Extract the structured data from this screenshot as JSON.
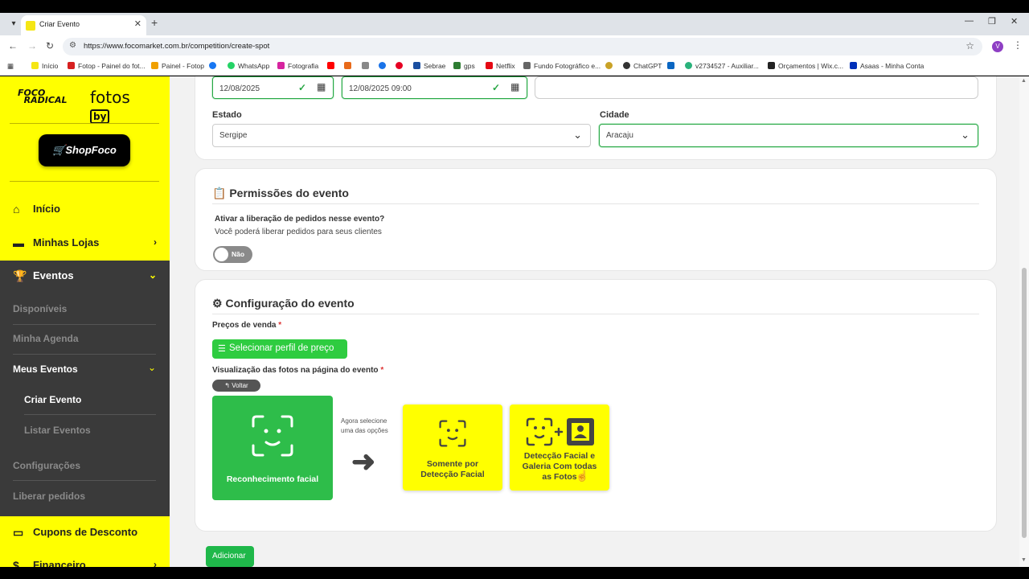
{
  "browser": {
    "tab_title": "Criar Evento",
    "url": "https://www.focomarket.com.br/competition/create-spot",
    "profile_initial": "V",
    "bookmarks": [
      {
        "label": "Início",
        "color": "#f5e614"
      },
      {
        "label": "Fotop - Painel do fot...",
        "color": "#d62020"
      },
      {
        "label": "Painel - Fotop",
        "color": "#f0a000"
      },
      {
        "label": "",
        "color": "#1877f2"
      },
      {
        "label": "WhatsApp",
        "color": "#25d366"
      },
      {
        "label": "Fotografia",
        "color": "#d6249f"
      },
      {
        "label": "",
        "color": "#ff0000"
      },
      {
        "label": "",
        "color": "#e86a1a"
      },
      {
        "label": "",
        "color": "#888888"
      },
      {
        "label": "",
        "color": "#1a73e8"
      },
      {
        "label": "",
        "color": "#e60023"
      },
      {
        "label": "Sebrae",
        "color": "#1a4fa0"
      },
      {
        "label": "gps",
        "color": "#2e7d32"
      },
      {
        "label": "Netflix",
        "color": "#e50914"
      },
      {
        "label": "Fundo Fotográfico e...",
        "color": "#666666"
      },
      {
        "label": "",
        "color": "#c9a227"
      },
      {
        "label": "ChatGPT",
        "color": "#333333"
      },
      {
        "label": "",
        "color": "#0a66c2"
      },
      {
        "label": "v2734527 - Auxiliar...",
        "color": "#2ab27b"
      },
      {
        "label": "Orçamentos | Wix.c...",
        "color": "#222222"
      },
      {
        "label": "Asaas - Minha Conta",
        "color": "#0030b9"
      }
    ]
  },
  "sidebar": {
    "brand": "fotos by",
    "brand_left": "FOCO RADICAL",
    "shop_label": "ShopFoco",
    "items": {
      "inicio": "Início",
      "minhas_lojas": "Minhas Lojas",
      "eventos": "Eventos",
      "disponiveis": "Disponíveis",
      "minha_agenda": "Minha Agenda",
      "meus_eventos": "Meus Eventos",
      "criar_evento": "Criar Evento",
      "listar_eventos": "Listar Eventos",
      "configuracoes": "Configurações",
      "liberar_pedidos": "Liberar pedidos",
      "cupons": "Cupons de Desconto",
      "financeiro": "Financeiro"
    }
  },
  "form": {
    "date_start": "12/08/2025",
    "date_end": "12/08/2025 09:00",
    "estado_label": "Estado",
    "estado_value": "Sergipe",
    "cidade_label": "Cidade",
    "cidade_value": "Aracaju",
    "permissoes_title": "Permissões do evento",
    "ativar_label": "Ativar a liberação de pedidos nesse evento?",
    "ativar_help": "Você poderá liberar pedidos para seus clientes",
    "toggle_label": "Não",
    "config_title": "Configuração do evento",
    "precos_label": "Preços de venda",
    "required_mark": "*",
    "perfil_button": "Selecionar perfil de preço",
    "visualizacao_label": "Visualização das fotos na página do evento",
    "voltar_button": "Voltar",
    "option_facial": "Reconhecimento facial",
    "hint": "Agora selecione uma das opções",
    "option_deteccao": "Somente por Detecção Facial",
    "option_galeria": "Detecção Facial e Galeria Com todas as Fotos",
    "adicionar_button": "Adicionar"
  }
}
